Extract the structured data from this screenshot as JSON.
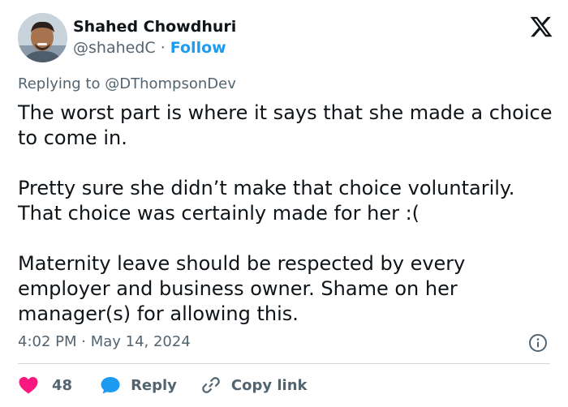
{
  "author": {
    "display_name": "Shahed Chowdhuri",
    "handle": "@shahedC",
    "separator": "·",
    "follow_label": "Follow"
  },
  "reply_context": {
    "prefix": "Replying to",
    "mention": "@DThompsonDev"
  },
  "tweet": {
    "paragraphs": [
      "The worst part is where it says that she made a choice to come in.",
      "Pretty sure she didn’t make that choice voluntarily. That choice was certainly made for her :(",
      "Maternity leave should be respected by every employer and business owner. Shame on her manager(s) for allowing this."
    ],
    "timestamp": "4:02 PM · May 14, 2024"
  },
  "actions": {
    "like_count": "48",
    "reply_label": "Reply",
    "copy_link_label": "Copy link"
  },
  "icons": {
    "logo": "x-logo-icon",
    "info": "info-icon",
    "like": "heart-icon",
    "reply": "speech-bubble-icon",
    "copy": "link-icon"
  },
  "colors": {
    "text": "#0f1419",
    "secondary": "#536471",
    "accent": "#1d9bf0",
    "like": "#f91880",
    "divider": "#cfd9de"
  }
}
